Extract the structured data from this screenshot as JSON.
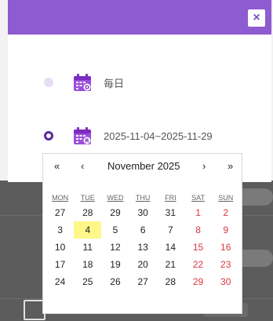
{
  "dialog": {
    "close_label": "×",
    "options": [
      {
        "label": "毎日",
        "selected": false
      },
      {
        "label": "2025-11-04~2025-11-29",
        "selected": true
      }
    ]
  },
  "calendar": {
    "nav": {
      "prev_year": "«",
      "prev_month": "‹",
      "next_month": "›",
      "next_year": "»"
    },
    "title": "November 2025",
    "weekdays": [
      "MON",
      "TUE",
      "WED",
      "THU",
      "FRI",
      "SAT",
      "SUN"
    ],
    "weeks": [
      [
        "27",
        "28",
        "29",
        "30",
        "31",
        "1",
        "2"
      ],
      [
        "3",
        "4",
        "5",
        "6",
        "7",
        "8",
        "9"
      ],
      [
        "10",
        "11",
        "12",
        "13",
        "14",
        "15",
        "16"
      ],
      [
        "17",
        "18",
        "19",
        "20",
        "21",
        "22",
        "23"
      ],
      [
        "24",
        "25",
        "26",
        "27",
        "28",
        "29",
        "30"
      ]
    ],
    "highlighted_day": "4"
  },
  "colors": {
    "header": "#8e5bd0",
    "radio_selected": "#5b2a9e",
    "weekend": "#d9363e",
    "today_bg": "#fff78a"
  },
  "icons": {
    "close": "close-icon",
    "calendar_daily": "calendar-d-icon",
    "calendar_range": "calendar-r-icon"
  }
}
